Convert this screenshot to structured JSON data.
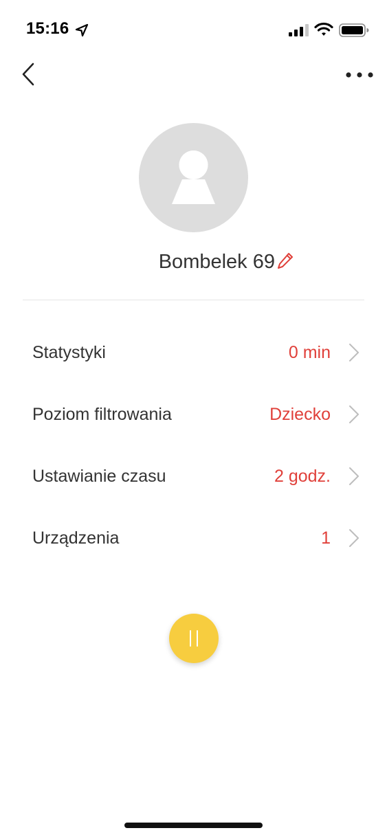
{
  "status_bar": {
    "time": "15:16",
    "icons": [
      "location-arrow-icon",
      "signal-icon",
      "wifi-icon",
      "battery-icon"
    ]
  },
  "nav": {
    "back_icon": "chevron-left-icon",
    "more_icon": "ellipsis-icon"
  },
  "profile": {
    "name": "Bombelek 69",
    "avatar_icon": "user-placeholder-icon",
    "edit_icon": "pencil-icon"
  },
  "menu": {
    "items": [
      {
        "label": "Statystyki",
        "value": "0 min"
      },
      {
        "label": "Poziom filtrowania",
        "value": "Dziecko"
      },
      {
        "label": "Ustawianie czasu",
        "value": "2 godz."
      },
      {
        "label": "Urządzenia",
        "value": "1"
      }
    ]
  },
  "pause": {
    "icon": "pause-icon"
  },
  "colors": {
    "accent": "#e0403a",
    "pause_button": "#f7cd3f",
    "avatar_bg": "#dddddd",
    "divider": "#e6e6e6",
    "chevron": "#bdbdbd"
  }
}
